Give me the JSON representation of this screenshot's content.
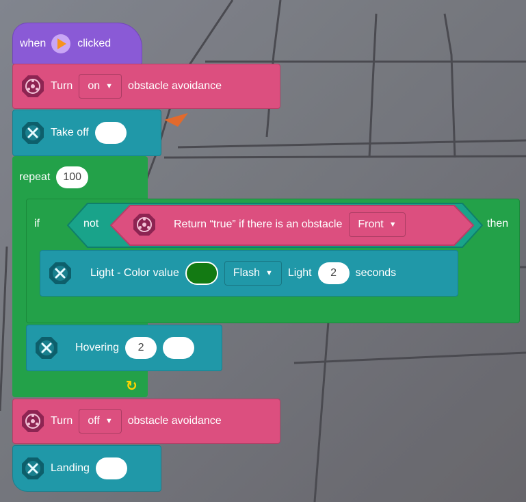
{
  "hat": {
    "when": "when",
    "clicked": "clicked"
  },
  "obstacle_on": {
    "turn": "Turn",
    "value": "on",
    "suffix": "obstacle avoidance"
  },
  "take_off": {
    "label": "Take off",
    "value": ""
  },
  "repeat": {
    "label": "repeat",
    "count": "100"
  },
  "if_block": {
    "if": "if",
    "not": "not",
    "then": "then"
  },
  "obstacle_check": {
    "label": "Return “true” if there is an obstacle",
    "direction": "Front"
  },
  "light": {
    "label": "Light - Color value",
    "color": "#137a13",
    "mode": "Flash",
    "light": "Light",
    "seconds_value": "2",
    "seconds": "seconds"
  },
  "hovering": {
    "label": "Hovering",
    "value": "2",
    "value2": ""
  },
  "obstacle_off": {
    "turn": "Turn",
    "value": "off",
    "suffix": "obstacle avoidance"
  },
  "landing": {
    "label": "Landing",
    "value": ""
  },
  "loop_arrow": "↻",
  "colors": {
    "events": "#8a5ad6",
    "sensing": "#dc4f7f",
    "motion": "#2098a8",
    "control": "#23a149"
  },
  "icons": {
    "flag": "play-flag-icon",
    "sensor": "sensor-icon",
    "drone": "drone-icon",
    "loop": "loop-arrow-icon"
  }
}
